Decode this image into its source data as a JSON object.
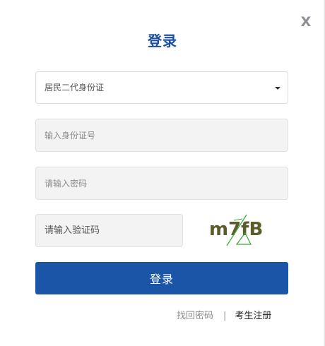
{
  "dialog": {
    "close_label": "X",
    "title": "登录"
  },
  "form": {
    "id_type": {
      "selected": "居民二代身份证",
      "options": [
        "居民二代身份证"
      ]
    },
    "id_number": {
      "placeholder": "输入身份证号",
      "value": ""
    },
    "password": {
      "placeholder": "请输入密码",
      "value": ""
    },
    "captcha": {
      "placeholder": "请输入验证码",
      "value": "",
      "image_text": "m7fB"
    },
    "submit_label": "登录"
  },
  "footer": {
    "forgot_password": "找回密码",
    "separator": "|",
    "register": "考生注册"
  },
  "colors": {
    "title": "#1a4e9e",
    "submit_bg": "#1b55a8",
    "captcha_text": "#5c5c2a",
    "captcha_noise": "#39a935"
  }
}
